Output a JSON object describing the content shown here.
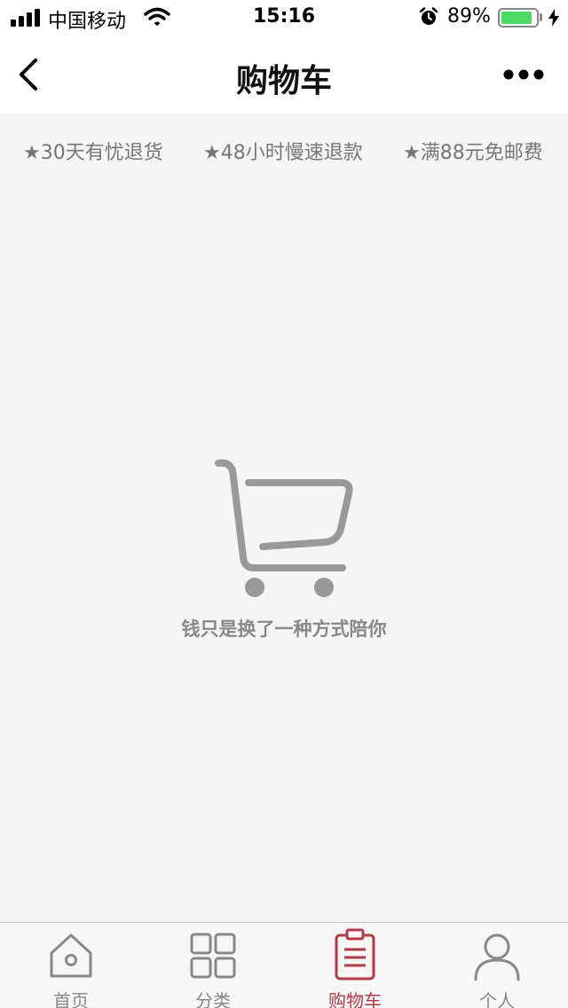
{
  "status_bar": {
    "carrier": "中国移动",
    "time": "15:16",
    "battery_percent": "89%",
    "battery_level": 0.89,
    "battery_color": "#4cd964"
  },
  "nav": {
    "title": "购物车",
    "back_icon": "chevron-left-icon",
    "more_icon": "more-dots-icon"
  },
  "promises": [
    "★30天有忧退货",
    "★48小时慢速退款",
    "★满88元免邮费"
  ],
  "empty_state": {
    "icon": "shopping-cart-icon",
    "message": "钱只是换了一种方式陪你"
  },
  "tabs": [
    {
      "label": "首页",
      "icon": "home-icon",
      "active": false
    },
    {
      "label": "分类",
      "icon": "category-grid-icon",
      "active": false
    },
    {
      "label": "购物车",
      "icon": "cart-clipboard-icon",
      "active": true
    },
    {
      "label": "个人",
      "icon": "person-icon",
      "active": false
    }
  ],
  "colors": {
    "accent": "#b03a45",
    "inactive": "#888888",
    "background": "#f5f5f5"
  }
}
